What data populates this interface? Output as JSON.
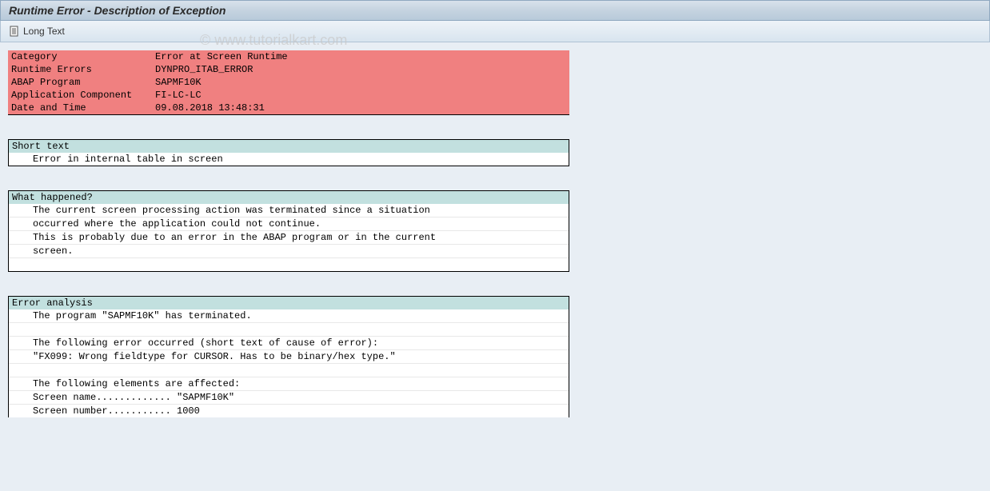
{
  "title": "Runtime Error - Description of Exception",
  "toolbar": {
    "long_text_label": "Long Text"
  },
  "watermark": "© www.tutorialkart.com",
  "info": {
    "rows": [
      {
        "label": "Category",
        "value": "Error at Screen Runtime"
      },
      {
        "label": "Runtime Errors",
        "value": "DYNPRO_ITAB_ERROR"
      },
      {
        "label": "ABAP Program",
        "value": "SAPMF10K"
      },
      {
        "label": "Application Component",
        "value": "FI-LC-LC"
      },
      {
        "label": "Date and Time",
        "value": "09.08.2018 13:48:31"
      }
    ]
  },
  "short_text": {
    "header": "Short text",
    "lines": [
      "Error in internal table in screen"
    ]
  },
  "what_happened": {
    "header": "What happened?",
    "lines": [
      "The current screen processing action was terminated since a situation",
      "occurred where the application could not continue.",
      "This is probably due to an error in the ABAP program or in the current",
      "screen.",
      ""
    ]
  },
  "error_analysis": {
    "header": "Error analysis",
    "lines": [
      "The program \"SAPMF10K\" has terminated.",
      "",
      "The following error occurred (short text of cause of error):",
      "\"FX099: Wrong fieldtype for CURSOR. Has to be binary/hex type.\"",
      "",
      "The following elements are affected:",
      "Screen name............. \"SAPMF10K\"",
      "Screen number........... 1000"
    ]
  }
}
